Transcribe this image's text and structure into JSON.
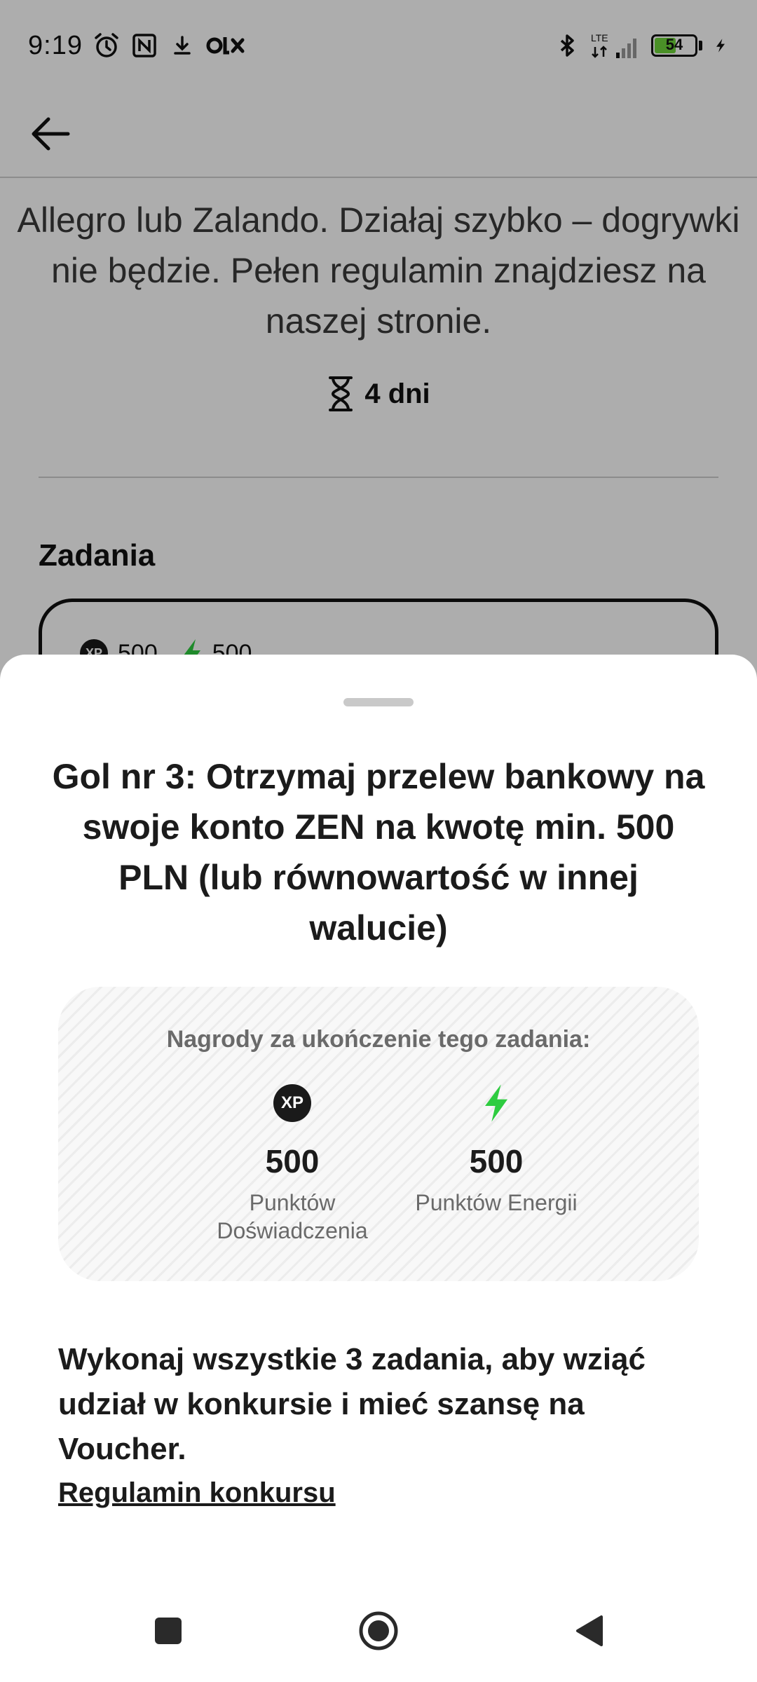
{
  "status_bar": {
    "time": "9:19",
    "network": "LTE",
    "battery_level": "54",
    "battery_fraction": 0.54,
    "icons": [
      "alarm-icon",
      "nfc-icon",
      "download-icon",
      "olx-app-icon",
      "bluetooth-icon",
      "lte-signal-icon",
      "battery-icon",
      "charging-icon"
    ]
  },
  "app_bar": {
    "back_icon": "arrow-left-icon"
  },
  "background": {
    "description": "Allegro lub Zalando. Działaj szybko – dogrywki nie będzie. Pełen regulamin znajdziesz na naszej stronie.",
    "duration": "4 dni",
    "section_title": "Zadania",
    "task_card": {
      "xp": "500",
      "energy": "500"
    }
  },
  "sheet": {
    "title": "Gol nr 3: Otrzymaj przelew bankowy na swoje konto ZEN na kwotę min. 500 PLN (lub równowartość w innej walucie)",
    "rewards": {
      "title": "Nagrody za ukończenie tego zadania:",
      "xp": {
        "badge": "XP",
        "value": "500",
        "label": "Punktów Doświadczenia"
      },
      "energy": {
        "value": "500",
        "label": "Punktów Energii"
      }
    },
    "info": "Wykonaj wszystkie 3 zadania, aby wziąć udział w konkursie i mieć szansę na Voucher.",
    "rules_link": "Regulamin konkursu"
  },
  "colors": {
    "energy_green": "#2ecc40",
    "text_dark": "#1b1b1b",
    "text_muted": "#6a6a6a",
    "battery_green": "#6dd53a"
  },
  "nav": {
    "icons": [
      "recents-square-icon",
      "home-circle-icon",
      "back-triangle-icon"
    ]
  }
}
